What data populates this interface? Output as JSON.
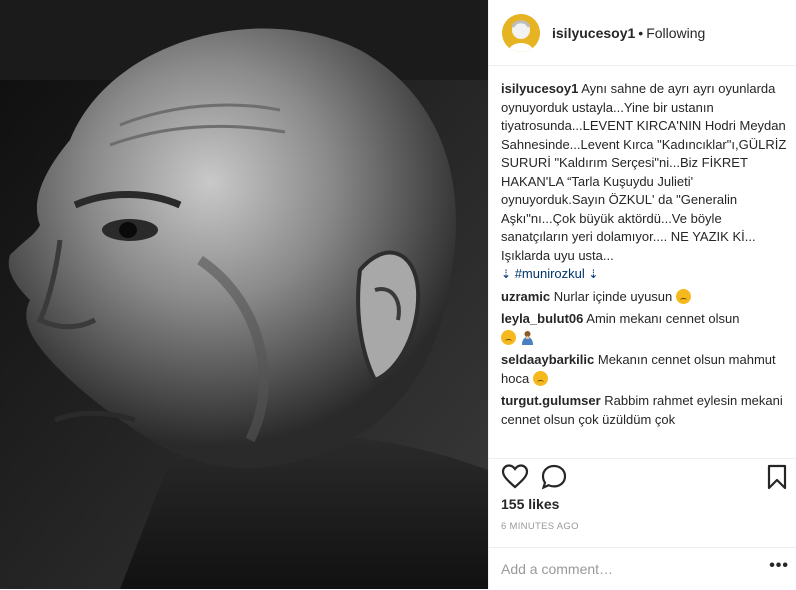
{
  "header": {
    "username": "isilyucesoy1",
    "separator": "•",
    "follow_status": "Following"
  },
  "caption": {
    "username": "isilyucesoy1",
    "text": "Aynı sahne de ayrı ayrı oyunlarda oynuyorduk ustayla...Yine bir ustanın tiyatrosunda...LEVENT KIRCA'NIN Hodri Meydan Sahnesinde...Levent Kırca \"Kadıncıklar\"ı,GÜLRİZ SURURİ \"Kaldırım Serçesi\"ni...Biz FİKRET HAKAN'LA “Tarla Kuşuydu Julieti' oynuyorduk.Sayın ÖZKUL' da \"Generalin Aşkı\"nı...Çok büyük aktördü...Ve böyle sanatçıların yeri dolamıyor.... NE YAZIK Kİ... Işıklarda uyu usta...",
    "hashtag_prefix": "⇣",
    "hashtag": "#munirozkul",
    "hashtag_suffix": "⇣"
  },
  "comments": [
    {
      "user": "uzramic",
      "text": "Nurlar içinde uyusun",
      "emoji": "sad-face"
    },
    {
      "user": "leyla_bulut06",
      "text": "Amin mekanı cennet olsun",
      "emoji": "sad-face-pray"
    },
    {
      "user": "seldaaybarkilic",
      "text": "Mekanın cennet olsun mahmut hoca",
      "emoji": "sad-face"
    },
    {
      "user": "turgut.gulumser",
      "text": "Rabbim rahmet eylesin mekani cennet olsun çok üzüldüm çok",
      "emoji": ""
    }
  ],
  "actions": {
    "likes": "155 likes",
    "time": "6 MINUTES AGO",
    "add_comment_placeholder": "Add a comment…",
    "more_label": "•••"
  },
  "icons": {
    "like": "heart-icon",
    "comment": "comment-bubble-icon",
    "save": "bookmark-icon",
    "more": "more-dots-icon"
  }
}
